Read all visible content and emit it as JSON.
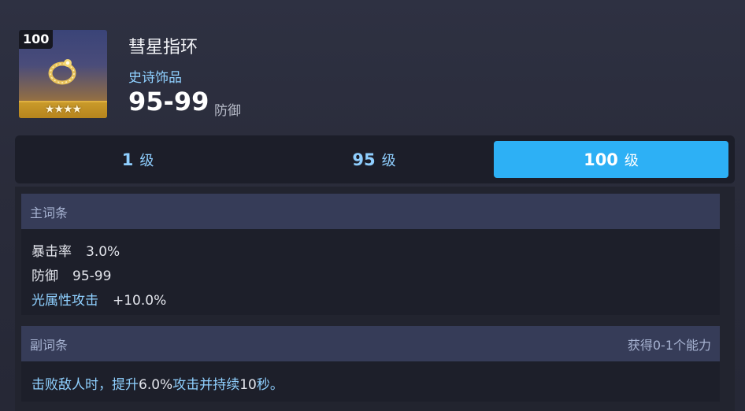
{
  "item": {
    "level_badge": "100",
    "stars": "★★★★",
    "name": "彗星指环",
    "type": "史诗饰品",
    "stat_value": "95-99",
    "stat_unit": "防御"
  },
  "tabs": [
    {
      "num": "1",
      "unit": "级",
      "active": false
    },
    {
      "num": "95",
      "unit": "级",
      "active": false
    },
    {
      "num": "100",
      "unit": "级",
      "active": true
    }
  ],
  "main_stats": {
    "title": "主词条",
    "rows": [
      {
        "label": "暴击率",
        "value": "3.0%"
      },
      {
        "label": "防御",
        "value": "95-99"
      },
      {
        "label": "光属性攻击",
        "value": "+10.0%"
      }
    ]
  },
  "sub_stats": {
    "title": "副词条",
    "right_note": "获得0-1个能力",
    "text_a": "击败敌人时，提升",
    "text_num": "6.0%",
    "text_b": "攻击并持续",
    "text_num2": "10",
    "text_c": "秒。"
  },
  "colors": {
    "accent": "#2db0f5",
    "highlight_text": "#8fd0ff",
    "rarity_gold": "#c18a2e"
  }
}
